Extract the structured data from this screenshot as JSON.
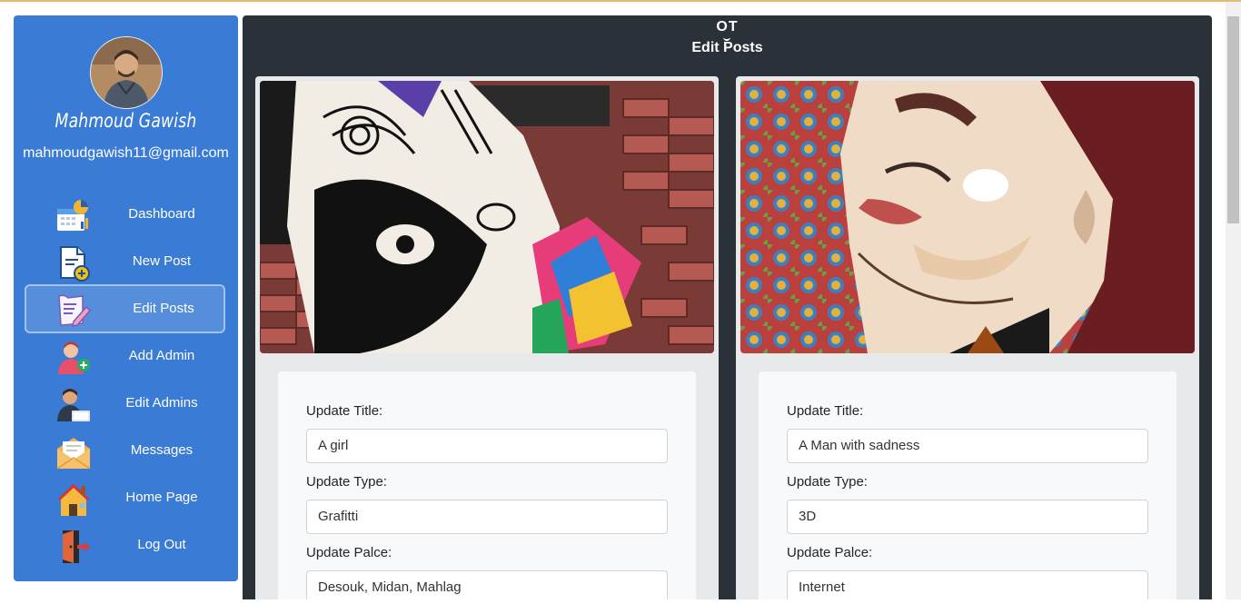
{
  "profile": {
    "name": "Mahmoud Gawish",
    "email": "mahmoudgawish11@gmail.com"
  },
  "nav": [
    {
      "label": "Dashboard",
      "icon": "dashboard-icon"
    },
    {
      "label": "New Post",
      "icon": "new-post-icon"
    },
    {
      "label": "Edit Posts",
      "icon": "edit-posts-icon",
      "active": true
    },
    {
      "label": "Add Admin",
      "icon": "add-admin-icon"
    },
    {
      "label": "Edit Admins",
      "icon": "edit-admins-icon"
    },
    {
      "label": "Messages",
      "icon": "messages-icon"
    },
    {
      "label": "Home Page",
      "icon": "home-icon"
    },
    {
      "label": "Log Out",
      "icon": "logout-icon"
    }
  ],
  "header": {
    "logo": "OT",
    "title": "Edit Posts"
  },
  "posts": [
    {
      "title_label": "Update Title:",
      "title_value": "A girl",
      "type_label": "Update Type:",
      "type_value": "Grafitti",
      "place_label": "Update Palce:",
      "place_value": "Desouk, Midan, Mahlag"
    },
    {
      "title_label": "Update Title:",
      "title_value": "A Man with sadness",
      "type_label": "Update Type:",
      "type_value": "3D",
      "place_label": "Update Palce:",
      "place_value": "Internet"
    }
  ],
  "colors": {
    "sidebar": "#3a7bd5",
    "main": "#2a3139",
    "card": "#e8e9ea"
  }
}
